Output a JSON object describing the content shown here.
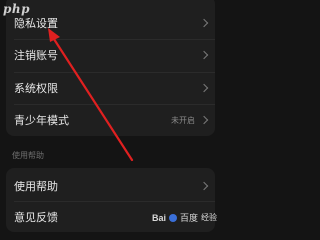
{
  "watermark_top": "php",
  "settings": {
    "items": [
      {
        "label": "隐私设置",
        "value": ""
      },
      {
        "label": "注销账号",
        "value": ""
      },
      {
        "label": "系统权限",
        "value": ""
      },
      {
        "label": "青少年模式",
        "value": "未开启"
      }
    ]
  },
  "help_section": {
    "title": "使用帮助",
    "items": [
      {
        "label": "使用帮助"
      },
      {
        "label": "意见反馈"
      }
    ]
  },
  "watermark_bottom": {
    "brand": "Bai",
    "brand2": "百度",
    "suffix": "经验"
  },
  "colors": {
    "background": "#141414",
    "card": "#1f1f1f",
    "annotation_arrow": "#e02020"
  }
}
